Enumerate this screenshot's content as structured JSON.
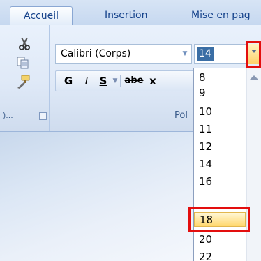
{
  "tabs": [
    {
      "label": "Accueil",
      "active": true
    },
    {
      "label": "Insertion",
      "active": false
    },
    {
      "label": "Mise en pag",
      "active": false
    }
  ],
  "clipboard": {
    "icons": [
      "scissors-icon",
      "copy-icon",
      "format-painter-icon"
    ],
    "group_label": ")...",
    "launcher_icon": "dialog-launcher-icon"
  },
  "font": {
    "name_value": "Calibri (Corps)",
    "size_value": "14",
    "group_label": "Pol"
  },
  "format_buttons": {
    "bold": "G",
    "italic": "I",
    "underline": "S",
    "strikethrough": "abe",
    "subscript": "x"
  },
  "size_list": {
    "options": [
      "8",
      "9",
      "10",
      "11",
      "12",
      "14",
      "16",
      "18",
      "20",
      "22"
    ],
    "selected": "18"
  },
  "colors": {
    "accent_blue": "#15428b",
    "highlight_red": "#e30e0e",
    "selection_gold": "#ffd86e"
  }
}
